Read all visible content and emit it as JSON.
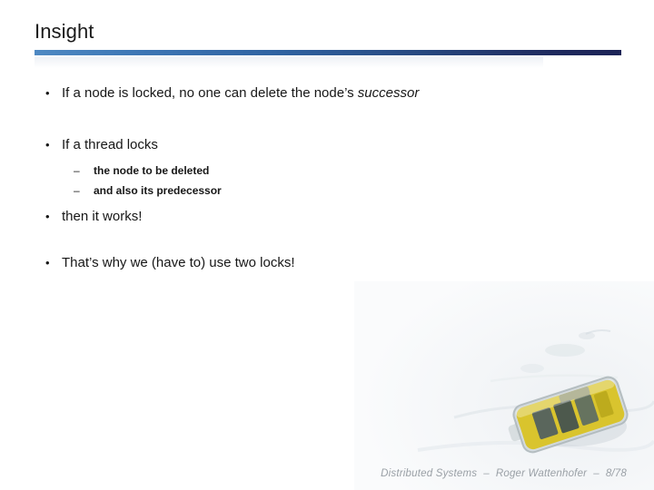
{
  "slide": {
    "title": "Insight",
    "accent_light": "#4e89c2",
    "accent_dark": "#1f2a5e",
    "background_color": "#ffffff"
  },
  "body": {
    "bullet_marker": "•",
    "subbullet_marker": "–",
    "items": [
      {
        "level": 1,
        "text_before_italic": "If a node is locked, no one can delete the node’s ",
        "italic_text": "successor",
        "text_after_italic": ""
      },
      {
        "level": 1,
        "text": "If a thread locks"
      },
      {
        "level": 2,
        "text": "the node to be deleted"
      },
      {
        "level": 2,
        "text": "and also its predecessor"
      },
      {
        "level": 1,
        "text": "then it works!"
      },
      {
        "level": 1,
        "text": "That’s why we (have to) use two locks!"
      }
    ]
  },
  "footer": {
    "course": "Distributed Systems",
    "separator_1": "–",
    "author": "Roger Wattenhofer",
    "separator_2": "–",
    "page": "8/78"
  },
  "background_image": {
    "name": "sensor-node-on-snow-photo",
    "snow_color": "#f4f6f8",
    "device_yellow": "#d9c21e",
    "device_gray": "#8f9aa0"
  }
}
